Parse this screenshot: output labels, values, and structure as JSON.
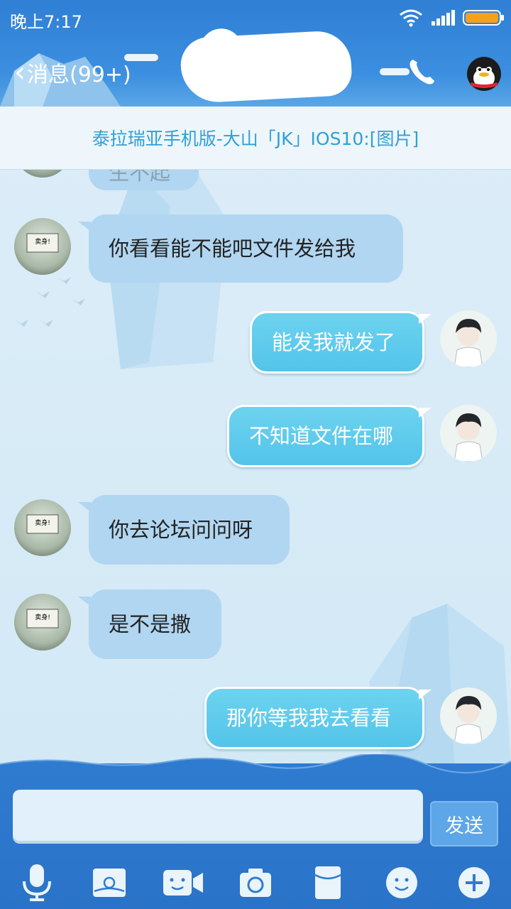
{
  "status": {
    "time": "晚上7:17"
  },
  "header": {
    "back_label": "消息(99+)",
    "contact_name": ""
  },
  "banner": {
    "text": "泰拉瑞亚手机版-大山「JK」IOS10:[图片]"
  },
  "partial_message": {
    "text": "生不起"
  },
  "messages": [
    {
      "sender": "them",
      "text": "你看看能不能吧文件发给我"
    },
    {
      "sender": "me",
      "text": "能发我就发了"
    },
    {
      "sender": "me",
      "text": "不知道文件在哪"
    },
    {
      "sender": "them",
      "text": "你去论坛问问呀"
    },
    {
      "sender": "them",
      "text": "是不是撒"
    },
    {
      "sender": "me",
      "text": "那你等我我去看看"
    }
  ],
  "avatar_them_caption": "卖身!",
  "input": {
    "placeholder": "",
    "send_label": "发送"
  },
  "toolbar": [
    "voice-icon",
    "picture-icon",
    "video-call-icon",
    "camera-icon",
    "red-packet-icon",
    "emoji-icon",
    "more-plus-icon"
  ],
  "colors": {
    "header": "#2f7fd4",
    "bubble_them": "#b1d6f1",
    "bubble_me": "#53c4ea",
    "banner_text": "#2ea1d6"
  }
}
